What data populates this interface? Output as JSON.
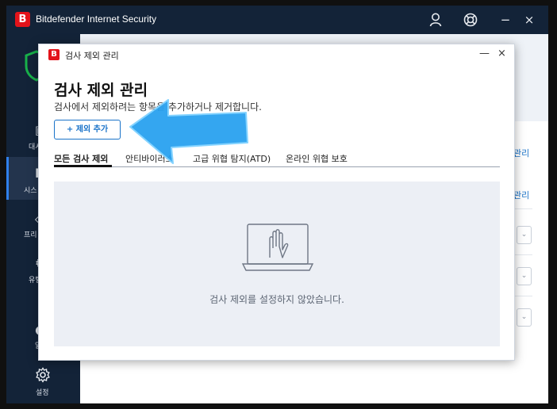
{
  "app": {
    "logo_letter": "B",
    "title": "Bitdefender Internet Security",
    "account_icon": "person-icon",
    "help_icon": "lifebuoy-icon",
    "minimize": "−",
    "close": "×"
  },
  "sidebar": {
    "items": [
      {
        "label": "대시",
        "icon": "dashboard-icon"
      },
      {
        "label": "시스",
        "icon": "system-icon"
      },
      {
        "label": "프리",
        "icon": "privacy-icon"
      },
      {
        "label": "유틸",
        "icon": "utilities-icon"
      },
      {
        "label": "알",
        "icon": "notifications-icon"
      },
      {
        "label": "설정",
        "icon": "gear-icon"
      }
    ]
  },
  "background": {
    "manage_link_1": "관리",
    "manage_link_2": "관리",
    "dropdown_chevron": "⌄"
  },
  "dialog": {
    "logo_letter": "B",
    "title": "검사 제외 관리",
    "minimize": "—",
    "close": "×",
    "heading": "검사 제외 관리",
    "subtitle": "검사에서 제외하려는 항목을 추가하거나 제거합니다.",
    "add_button": "+ 제외 추가",
    "tabs": [
      {
        "label": "모든 검사 제외",
        "active": true
      },
      {
        "label": "안티바이러스",
        "active": false
      },
      {
        "label": "고급 위협 탐지(ATD)",
        "active": false
      },
      {
        "label": "온라인 위협 보호",
        "active": false
      }
    ],
    "empty_message": "검사 제외를 설정하지 않았습니다.",
    "empty_icon": "laptop-hand-icon"
  },
  "annotation": {
    "arrow_icon": "blue-pointer-arrow-icon",
    "color": "#2aa2f0"
  }
}
